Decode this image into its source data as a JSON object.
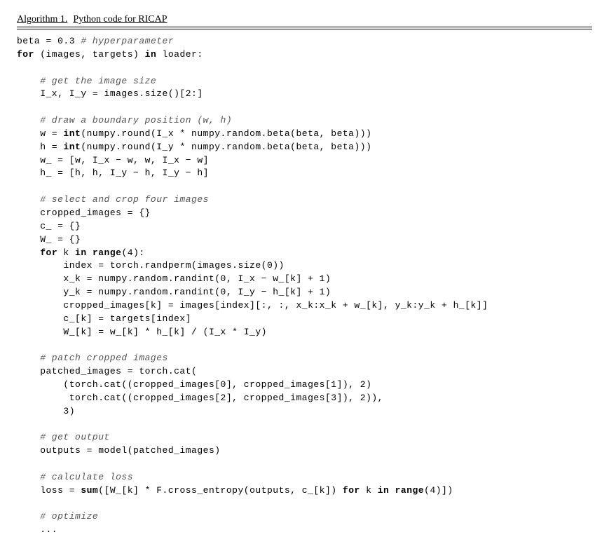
{
  "header": {
    "label": "Algorithm 1.",
    "title": "Python code for RICAP"
  },
  "code": {
    "l01_a": "beta = 0.3 ",
    "l01_c": "# hyperparameter",
    "l02_a": "for",
    "l02_b": " (images, targets) ",
    "l02_c": "in",
    "l02_d": " loader:",
    "blank": "",
    "l03_c": "    # get the image size",
    "l04": "    I_x, I_y = images.size()[2:]",
    "l05_c": "    # draw a boundary position (w, h)",
    "l06_a": "    w = ",
    "l06_b": "int",
    "l06_c": "(numpy.round(I_x * numpy.random.beta(beta, beta)))",
    "l07_a": "    h = ",
    "l07_b": "int",
    "l07_c": "(numpy.round(I_y * numpy.random.beta(beta, beta)))",
    "l08": "    w_ = [w, I_x − w, w, I_x − w]",
    "l09": "    h_ = [h, h, I_y − h, I_y − h]",
    "l10_c": "    # select and crop four images",
    "l11": "    cropped_images = {}",
    "l12": "    c_ = {}",
    "l13": "    W_ = {}",
    "l14_a": "    ",
    "l14_b": "for",
    "l14_c": " k ",
    "l14_d": "in",
    "l14_e": " ",
    "l14_f": "range",
    "l14_g": "(4):",
    "l15": "        index = torch.randperm(images.size(0))",
    "l16": "        x_k = numpy.random.randint(0, I_x − w_[k] + 1)",
    "l17": "        y_k = numpy.random.randint(0, I_y − h_[k] + 1)",
    "l18": "        cropped_images[k] = images[index][:, :, x_k:x_k + w_[k], y_k:y_k + h_[k]]",
    "l19": "        c_[k] = targets[index]",
    "l20": "        W_[k] = w_[k] * h_[k] / (I_x * I_y)",
    "l21_c": "    # patch cropped images",
    "l22": "    patched_images = torch.cat(",
    "l23": "        (torch.cat((cropped_images[0], cropped_images[1]), 2)",
    "l24": "         torch.cat((cropped_images[2], cropped_images[3]), 2)),",
    "l25": "        3)",
    "l26_c": "    # get output",
    "l27": "    outputs = model(patched_images)",
    "l28_c": "    # calculate loss",
    "l29_a": "    loss = ",
    "l29_b": "sum",
    "l29_c": "([W_[k] * F.cross_entropy(outputs, c_[k]) ",
    "l29_d": "for",
    "l29_e": " k ",
    "l29_f": "in",
    "l29_g": " ",
    "l29_h": "range",
    "l29_i": "(4)])",
    "l30_c": "    # optimize",
    "l31": "    ..."
  }
}
